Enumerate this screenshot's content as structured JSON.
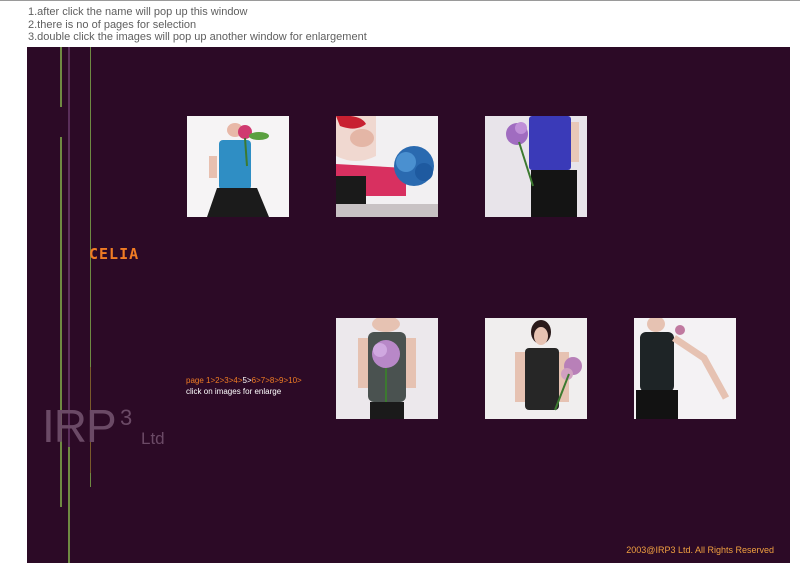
{
  "instructions": [
    "1.after click the name will pop up this window",
    "2.there is no of pages for selection",
    "3.double click the images will pop up another window for enlargement"
  ],
  "model_name": "CELIA",
  "pager": {
    "label": "page",
    "pages": [
      "1>",
      "2>",
      "3>",
      "4>",
      "5>",
      "6>",
      "7>",
      "8>",
      "9>",
      "10>"
    ],
    "current_page": "5>",
    "hint": "click on images for enlarge"
  },
  "logo": {
    "main": "IRP",
    "superscript": "3",
    "suffix": "Ltd"
  },
  "copyright": "2003@IRP3 Ltd. All Rights Reserved",
  "colors": {
    "panel_bg": "#2c0a26",
    "accent_orange": "#f07c24",
    "line_green": "#6f8a42",
    "line_purple": "#5a2e5a",
    "logo_grey": "#6b4a66"
  },
  "thumbnails": [
    {
      "id": "photo-1",
      "subject": "model in blue top holding flower"
    },
    {
      "id": "photo-2",
      "subject": "model with blue hydrangea"
    },
    {
      "id": "photo-3",
      "subject": "model in blue top with purple flower"
    },
    {
      "id": "photo-4",
      "subject": "model in grey top with hydrangea"
    },
    {
      "id": "photo-5",
      "subject": "model in black top with flowers"
    },
    {
      "id": "photo-6",
      "subject": "model in black sleeveless top"
    }
  ]
}
